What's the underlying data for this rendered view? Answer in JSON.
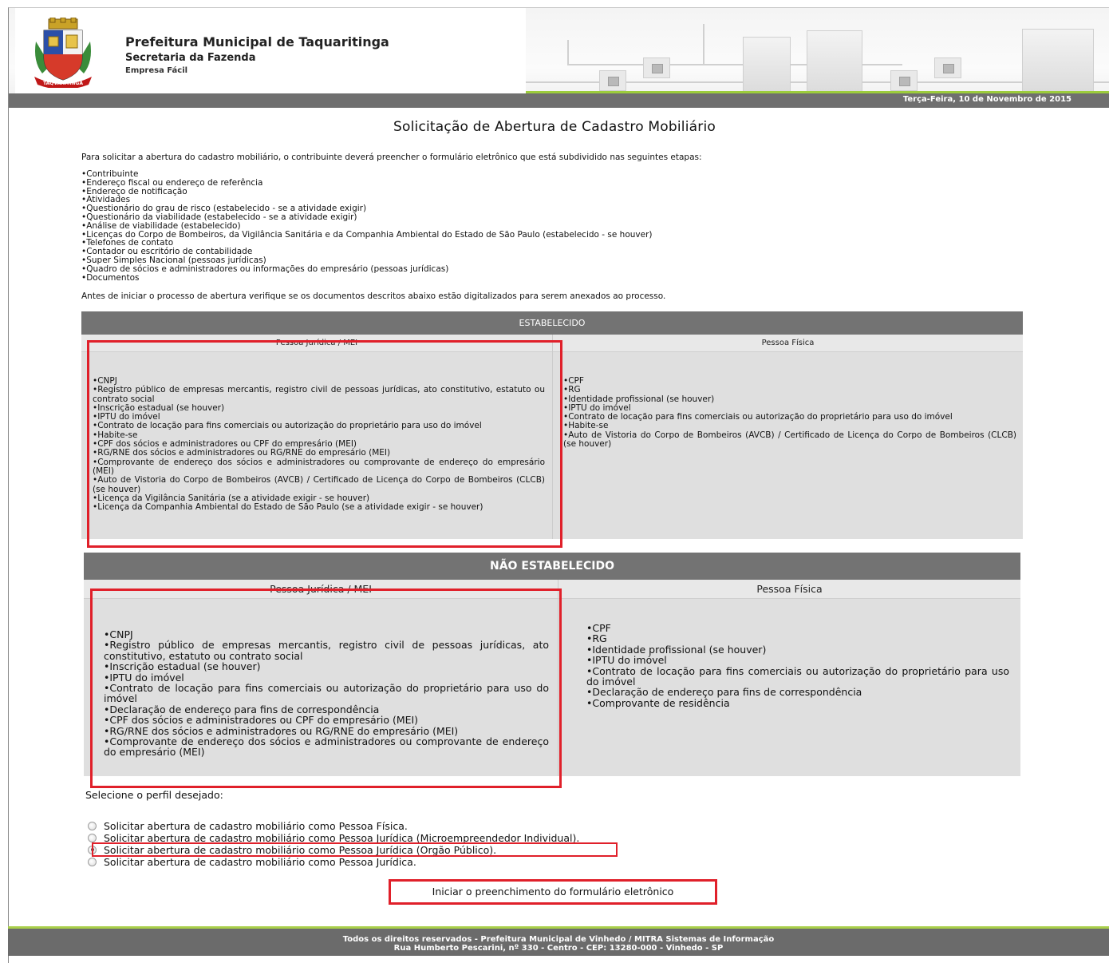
{
  "header": {
    "title": "Prefeitura Municipal de Taquaritinga",
    "subtitle": "Secretaria da Fazenda",
    "subtitle2": "Empresa Fácil",
    "date": "Terça-Feira, 10 de Novembro de 2015",
    "crest_icon": "municipal-crest",
    "crest_ribbon": "TAQVARITINGA"
  },
  "main": {
    "title": "Solicitação de Abertura de Cadastro Mobiliário",
    "intro": "Para solicitar a abertura do cadastro mobiliário, o contribuinte deverá preencher o formulário eletrônico que está subdividido nas seguintes etapas:",
    "steps": [
      "Contribuinte",
      "Endereço fiscal ou endereço de referência",
      "Endereço de notificação",
      "Atividades",
      "Questionário do grau de risco (estabelecido - se a atividade exigir)",
      "Questionário da viabilidade (estabelecido - se a atividade exigir)",
      "Análise de viabilidade (estabelecido)",
      "Licenças do Corpo de Bombeiros, da Vigilância Sanitária e da Companhia Ambiental do Estado de São Paulo (estabelecido - se houver)",
      "Telefones de contato",
      "Contador ou escritório de contabilidade",
      "Super Simples Nacional (pessoas jurídicas)",
      "Quadro de sócios e administradores ou informações do empresário (pessoas jurídicas)",
      "Documentos"
    ],
    "before_text": "Antes de iniciar o processo de abertura verifique se os documentos descritos abaixo estão digitalizados para serem anexados ao processo."
  },
  "estabelecido": {
    "heading": "ESTABELECIDO",
    "pj_heading": "Pessoa Jurídica / MEI",
    "pf_heading": "Pessoa Física",
    "pj_items": [
      "CNPJ",
      "Registro público de empresas mercantis, registro civil de pessoas jurídicas, ato constitutivo, estatuto ou contrato social",
      "Inscrição estadual (se houver)",
      "IPTU do imóvel",
      "Contrato de locação para fins comerciais ou autorização do proprietário para uso do imóvel",
      "Habite-se",
      "CPF dos sócios e administradores ou CPF do empresário (MEI)",
      "RG/RNE dos sócios e administradores ou RG/RNE do empresário (MEI)",
      "Comprovante de endereço dos sócios e administradores ou comprovante de endereço do empresário (MEI)",
      "Auto de Vistoria do Corpo de Bombeiros (AVCB) / Certificado de Licença do Corpo de Bombeiros (CLCB) (se houver)",
      "Licença da Vigilância Sanitária (se a atividade exigir - se houver)",
      "Licença da Companhia Ambiental do Estado de São Paulo (se a atividade exigir - se houver)"
    ],
    "pf_items": [
      "CPF",
      "RG",
      "Identidade profissional (se houver)",
      "IPTU do imóvel",
      "Contrato de locação para fins comerciais ou autorização do proprietário para uso do imóvel",
      "Habite-se",
      "Auto de Vistoria do Corpo de Bombeiros (AVCB) / Certificado de Licença do Corpo de Bombeiros (CLCB) (se houver)"
    ]
  },
  "nao_estabelecido": {
    "heading": "NÃO ESTABELECIDO",
    "pj_heading": "Pessoa Jurídica / MEI",
    "pf_heading": "Pessoa Física",
    "pj_items": [
      "CNPJ",
      "Registro público de empresas mercantis, registro civil de pessoas jurídicas, ato constitutivo, estatuto ou contrato social",
      "Inscrição estadual (se houver)",
      "IPTU do imóvel",
      "Contrato de locação para fins comerciais ou autorização do proprietário para uso do imóvel",
      "Declaração de endereço para fins de correspondência",
      "CPF dos sócios e administradores ou CPF do empresário (MEI)",
      "RG/RNE dos sócios e administradores ou RG/RNE do empresário (MEI)",
      "Comprovante de endereço dos sócios e administradores ou comprovante de endereço do empresário (MEI)"
    ],
    "pf_items": [
      "CPF",
      "RG",
      "Identidade profissional (se houver)",
      "IPTU do imóvel",
      "Contrato de locação para fins comerciais ou autorização do proprietário para uso do imóvel",
      "Declaração de endereço para fins de correspondência",
      "Comprovante de residência"
    ]
  },
  "profile": {
    "label": "Selecione o perfil desejado:",
    "options": [
      {
        "label": "Solicitar abertura de cadastro mobiliário como Pessoa Física.",
        "checked": false
      },
      {
        "label": "Solicitar abertura de cadastro mobiliário como Pessoa Jurídica (Microempreendedor Individual).",
        "checked": false
      },
      {
        "label": "Solicitar abertura de cadastro mobiliário como Pessoa Jurídica (Orgão Público).",
        "checked": true
      },
      {
        "label": "Solicitar abertura de cadastro mobiliário como Pessoa Jurídica.",
        "checked": false
      }
    ],
    "start_button": "Iniciar o preenchimento do formulário eletrônico"
  },
  "footer": {
    "line1": "Todos os direitos reservados - Prefeitura Municipal de Vinhedo / MITRA Sistemas de Informação",
    "line2": "Rua Humberto Pescarini, nº 330 - Centro - CEP: 13280-000 - Vinhedo - SP"
  },
  "colors": {
    "highlight": "#e0202a",
    "accent_green": "#9ccc3c",
    "header_gray": "#737373"
  }
}
